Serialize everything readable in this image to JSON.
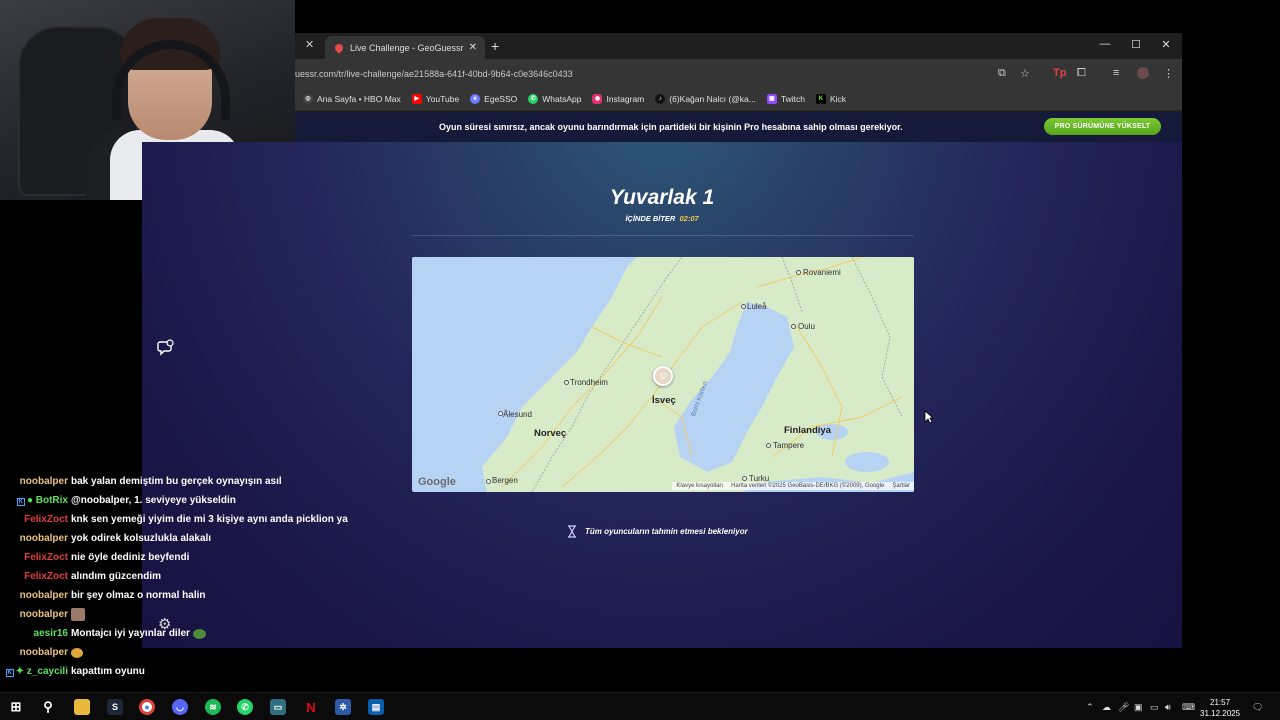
{
  "browser": {
    "tab_title": "Live Challenge - GeoGuessr",
    "url": "uessr.com/tr/live-challenge/ae21588a-641f-40bd-9b64-c0e3646c0433",
    "bookmarks": [
      {
        "label": "Ana Sayfa • HBO Max",
        "icon": "hbo-icon",
        "color": "#ffffff"
      },
      {
        "label": "YouTube",
        "icon": "youtube-icon",
        "color": "#ff0000"
      },
      {
        "label": "EgeSSO",
        "icon": "egesso-icon",
        "color": "#6b7cff"
      },
      {
        "label": "WhatsApp",
        "icon": "whatsapp-icon",
        "color": "#25d366"
      },
      {
        "label": "Instagram",
        "icon": "instagram-icon",
        "color": "#e1306c"
      },
      {
        "label": "(6)Kağan Nalcı (@ka...",
        "icon": "tiktok-icon",
        "color": "#111111"
      },
      {
        "label": "Twitch",
        "icon": "twitch-icon",
        "color": "#9146ff"
      },
      {
        "label": "Kick",
        "icon": "kick-icon",
        "color": "#53fc18"
      }
    ]
  },
  "banner": {
    "text": "Oyun süresi sınırsız, ancak oyunu barındırmak için partideki bir kişinin Pro hesabına sahip olması gerekiyor.",
    "button": "PRO SÜRÜMÜNE YÜKSELT"
  },
  "game": {
    "round_title": "Yuvarlak 1",
    "timer_label": "İÇİNDE BİTER",
    "timer_value": "02:07",
    "waiting_text": "Tüm oyuncuların tahmin etmesi bekleniyor"
  },
  "map": {
    "labels": {
      "rovaniemi": "Rovaniemi",
      "lulea": "Luleå",
      "oulu": "Oulu",
      "trondheim": "Trondheim",
      "isvec": "İsveç",
      "alesund": "Ålesund",
      "norvec": "Norveç",
      "finlandiya": "Finlandiya",
      "tampere": "Tampere",
      "bothnia": "Botni Körfezi",
      "turku": "Turku",
      "bergen": "Bergen"
    },
    "google": "Google",
    "attr_keys": "Klavye kısayolları",
    "attr_data": "Harita verileri ©2025 GeoBasis-DE/BKG (©2009), Google",
    "attr_terms": "Şartlar"
  },
  "chat": [
    {
      "user": "noobalper",
      "text": "bak yalan demiştim bu gerçek oynayışın asıl",
      "color": "#e8c27a"
    },
    {
      "user": "BotRix",
      "text": "@noobalper, 1. seviyeye yükseldin",
      "color": "#5ee05e",
      "badges": true
    },
    {
      "user": "FelixZoct",
      "text": "knk sen yemeği yiyim die mi 3 kişiye aynı anda picklion ya",
      "color": "#e03b3b"
    },
    {
      "user": "noobalper",
      "text": "yok odirek kolsuzlukla alakalı",
      "color": "#e8c27a"
    },
    {
      "user": "FelixZoct",
      "text": "nie öyle dediniz beyfendi",
      "color": "#e03b3b"
    },
    {
      "user": "FelixZoct",
      "text": "alındım güzcendim",
      "color": "#e03b3b"
    },
    {
      "user": "noobalper",
      "text": "bir şey olmaz o normal halin",
      "color": "#e8c27a"
    },
    {
      "user": "noobalper",
      "text": "",
      "color": "#e8c27a",
      "emote": true
    },
    {
      "user": "aesir16",
      "text": "Montajcı iyi yayınlar diler",
      "color": "#5ee05e"
    },
    {
      "user": "noobalper",
      "text": "",
      "color": "#e8c27a",
      "emote": true
    },
    {
      "user": "z_caycili",
      "text": "kapattım oyunu",
      "color": "#5ee05e",
      "badges": true
    }
  ],
  "taskbar": {
    "time": "21:57",
    "date": "31.12.2025"
  }
}
